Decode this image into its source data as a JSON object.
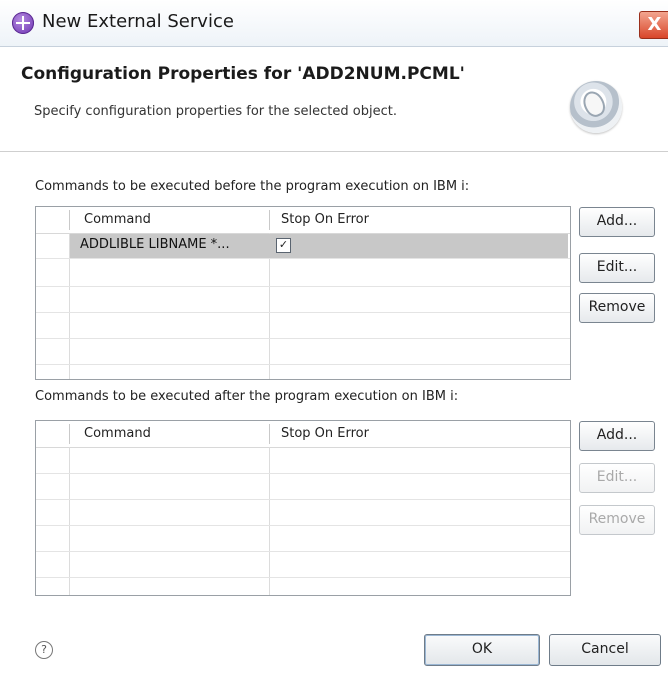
{
  "window": {
    "title": "New External Service",
    "close_label": "X"
  },
  "header": {
    "title": "Configuration Properties for 'ADD2NUM.PCML'",
    "description": "Specify configuration properties for the selected object."
  },
  "before_section": {
    "label": "Commands to be executed before the program execution on IBM i:",
    "columns": [
      "Command",
      "Stop On Error"
    ],
    "rows": [
      {
        "command": "ADDLIBLE LIBNAME *...",
        "stop_on_error": true
      }
    ],
    "buttons": {
      "add": "Add...",
      "edit": "Edit...",
      "remove": "Remove"
    }
  },
  "after_section": {
    "label": "Commands to be executed after the program execution on IBM i:",
    "columns": [
      "Command",
      "Stop On Error"
    ],
    "rows": [],
    "buttons": {
      "add": "Add...",
      "edit": "Edit...",
      "remove": "Remove"
    },
    "edit_enabled": false,
    "remove_enabled": false
  },
  "footer": {
    "help": "?",
    "ok": "OK",
    "cancel": "Cancel"
  }
}
